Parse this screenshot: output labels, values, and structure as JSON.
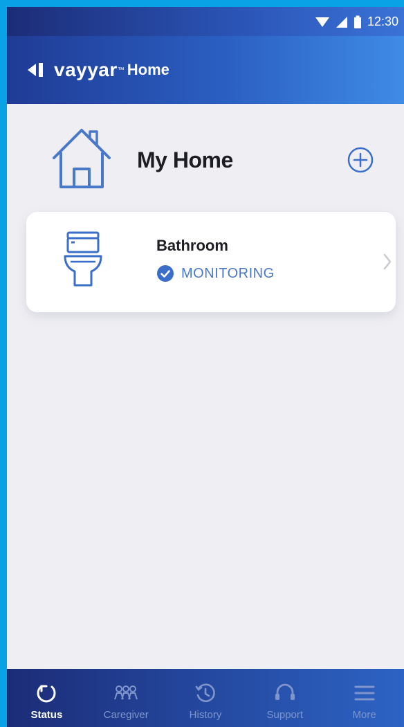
{
  "status_bar": {
    "time": "12:30"
  },
  "app_bar": {
    "brand": "vayyar",
    "trademark": "™",
    "product": "Home"
  },
  "home": {
    "title": "My Home"
  },
  "rooms": [
    {
      "name": "Bathroom",
      "status": "MONITORING"
    }
  ],
  "nav": {
    "items": [
      {
        "label": "Status",
        "icon": "status-icon",
        "active": true
      },
      {
        "label": "Caregiver",
        "icon": "caregiver-icon",
        "active": false
      },
      {
        "label": "History",
        "icon": "history-icon",
        "active": false
      },
      {
        "label": "Support",
        "icon": "support-icon",
        "active": false
      },
      {
        "label": "More",
        "icon": "menu-icon",
        "active": false
      }
    ]
  },
  "colors": {
    "screen_border": "#0aa2e6",
    "header_gradient_start": "#1f3b95",
    "header_gradient_end": "#3f8be6",
    "background": "#efeff3",
    "accent": "#3a6ec8",
    "nav_inactive": "#7f95cc"
  }
}
